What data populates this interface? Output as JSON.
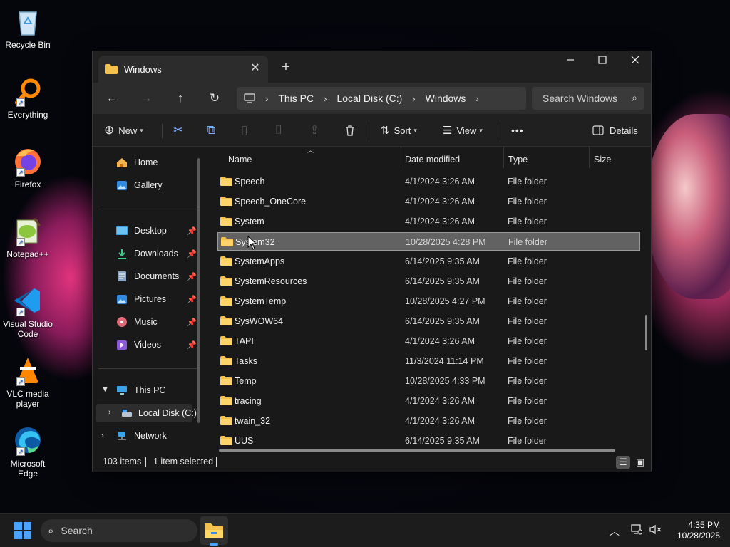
{
  "desktop": {
    "icons": [
      {
        "label": "Recycle Bin"
      },
      {
        "label": "Everything"
      },
      {
        "label": "Firefox"
      },
      {
        "label": "Notepad++"
      },
      {
        "label": "Visual Studio Code"
      },
      {
        "label": "VLC media player"
      },
      {
        "label": "Microsoft Edge"
      }
    ]
  },
  "window": {
    "tab_title": "Windows",
    "new_tab_glyph": "+",
    "breadcrumb": [
      "This PC",
      "Local Disk (C:)",
      "Windows"
    ],
    "search_placeholder": "Search Windows",
    "commands": {
      "new": "New",
      "sort": "Sort",
      "view": "View",
      "more": "•••",
      "details": "Details"
    },
    "sidebar": {
      "top": [
        {
          "label": "Home",
          "icon": "home-icon"
        },
        {
          "label": "Gallery",
          "icon": "gallery-icon"
        }
      ],
      "quick_access": [
        {
          "label": "Desktop",
          "icon": "desktop-folder-icon"
        },
        {
          "label": "Downloads",
          "icon": "downloads-folder-icon"
        },
        {
          "label": "Documents",
          "icon": "documents-folder-icon"
        },
        {
          "label": "Pictures",
          "icon": "pictures-folder-icon"
        },
        {
          "label": "Music",
          "icon": "music-folder-icon"
        },
        {
          "label": "Videos",
          "icon": "videos-folder-icon"
        }
      ],
      "this_pc": "This PC",
      "local_disk": "Local Disk (C:)",
      "network": "Network"
    },
    "columns": {
      "name": "Name",
      "date": "Date modified",
      "type": "Type",
      "size": "Size"
    },
    "rows": [
      {
        "name": "Speech",
        "date": "4/1/2024 3:26 AM",
        "type": "File folder"
      },
      {
        "name": "Speech_OneCore",
        "date": "4/1/2024 3:26 AM",
        "type": "File folder"
      },
      {
        "name": "System",
        "date": "4/1/2024 3:26 AM",
        "type": "File folder"
      },
      {
        "name": "System32",
        "date": "10/28/2025 4:28 PM",
        "type": "File folder",
        "selected": true
      },
      {
        "name": "SystemApps",
        "date": "6/14/2025 9:35 AM",
        "type": "File folder"
      },
      {
        "name": "SystemResources",
        "date": "6/14/2025 9:35 AM",
        "type": "File folder"
      },
      {
        "name": "SystemTemp",
        "date": "10/28/2025 4:27 PM",
        "type": "File folder"
      },
      {
        "name": "SysWOW64",
        "date": "6/14/2025 9:35 AM",
        "type": "File folder"
      },
      {
        "name": "TAPI",
        "date": "4/1/2024 3:26 AM",
        "type": "File folder"
      },
      {
        "name": "Tasks",
        "date": "11/3/2024 11:14 PM",
        "type": "File folder"
      },
      {
        "name": "Temp",
        "date": "10/28/2025 4:33 PM",
        "type": "File folder"
      },
      {
        "name": "tracing",
        "date": "4/1/2024 3:26 AM",
        "type": "File folder"
      },
      {
        "name": "twain_32",
        "date": "4/1/2024 3:26 AM",
        "type": "File folder"
      },
      {
        "name": "UUS",
        "date": "6/14/2025 9:35 AM",
        "type": "File folder"
      }
    ],
    "status": {
      "item_count": "103 items",
      "selection": "1 item selected"
    }
  },
  "taskbar": {
    "search_label": "Search",
    "time": "4:35 PM",
    "date": "10/28/2025"
  },
  "colors": {
    "accent": "#4aa3ff",
    "folder": "#f2c14e",
    "selected_row": "#626262"
  }
}
